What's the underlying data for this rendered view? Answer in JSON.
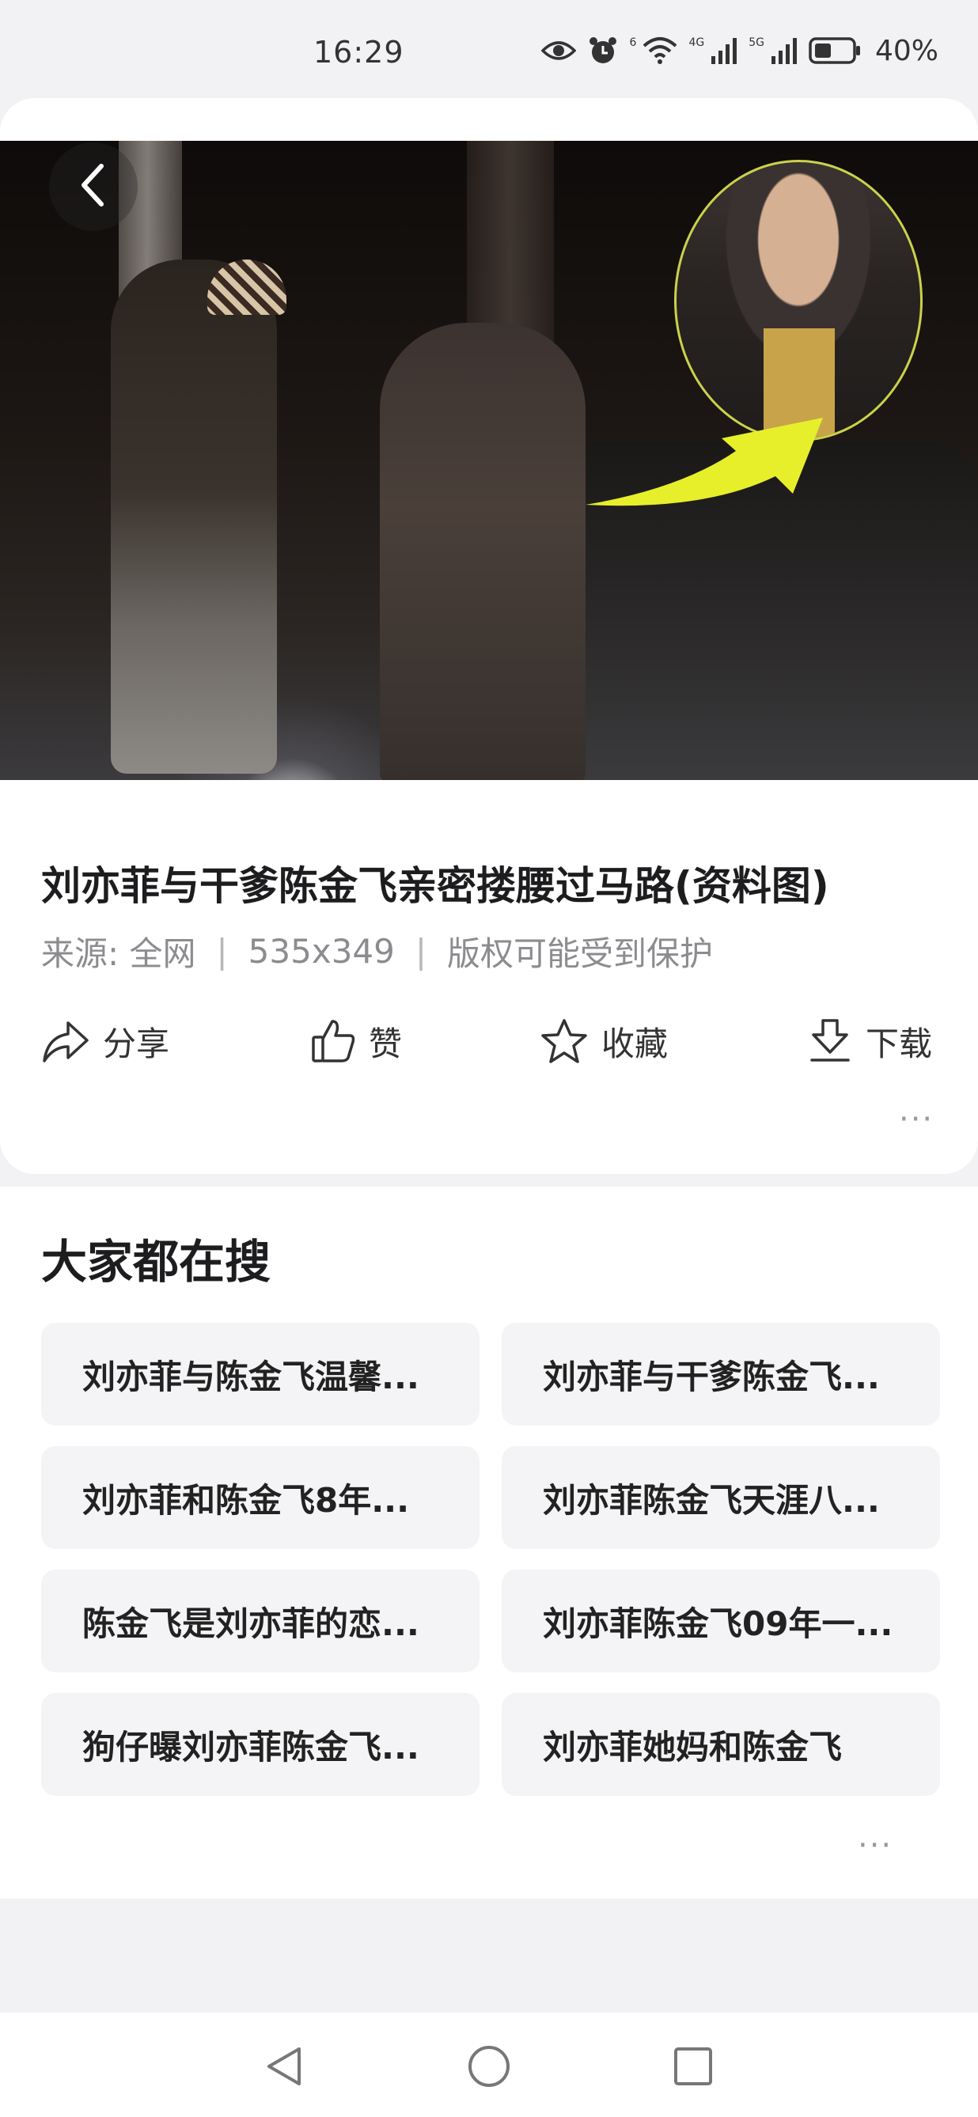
{
  "status_bar": {
    "time": "16:29",
    "battery_percent": "40%",
    "network_1": "4G",
    "network_2": "5G",
    "wifi_label": "6",
    "icons": [
      "eye-icon",
      "alarm-icon",
      "wifi-icon",
      "signal-4g-icon",
      "signal-5g-icon",
      "battery-icon"
    ]
  },
  "viewer": {
    "back_icon": "chevron-left-icon",
    "title": "刘亦菲与干爹陈金飞亲密搂腰过马路(资料图)",
    "source": "来源: 全网",
    "dimensions": "535x349",
    "copyright": "版权可能受到保护",
    "separator": "|",
    "actions": [
      {
        "label": "分享",
        "icon": "share-icon"
      },
      {
        "label": "赞",
        "icon": "thumbs-up-icon"
      },
      {
        "label": "收藏",
        "icon": "star-icon"
      },
      {
        "label": "下载",
        "icon": "download-icon"
      }
    ],
    "more": "···"
  },
  "related": {
    "title": "大家都在搜",
    "items": [
      "刘亦菲与陈金飞温馨...",
      "刘亦菲与干爹陈金飞...",
      "刘亦菲和陈金飞8年...",
      "刘亦菲陈金飞天涯八...",
      "陈金飞是刘亦菲的恋...",
      "刘亦菲陈金飞09年一...",
      "狗仔曝刘亦菲陈金飞...",
      "刘亦菲她妈和陈金飞"
    ],
    "more": "···"
  },
  "nav_bar": {
    "icons": [
      "nav-back-icon",
      "nav-home-icon",
      "nav-recents-icon"
    ]
  },
  "colors": {
    "background": "#f2f2f4",
    "card": "#ffffff",
    "chip": "#f4f4f6",
    "text_primary": "#1d1d1f",
    "text_secondary": "#8c8c90",
    "highlight_arrow": "#e6ef2a"
  }
}
